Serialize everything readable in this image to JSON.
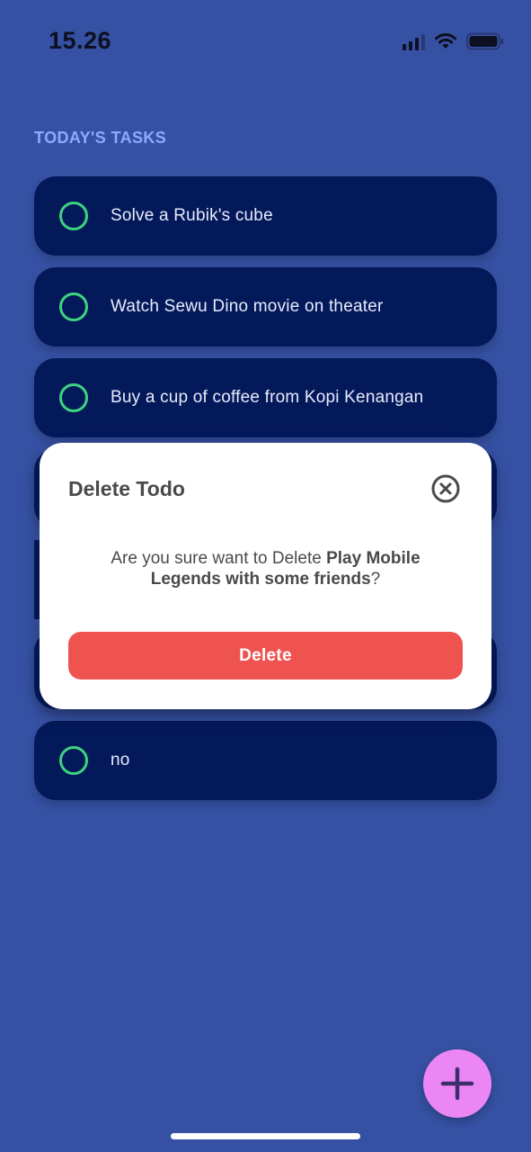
{
  "status_bar": {
    "time": "15.26",
    "icons": [
      "cellular-signal-icon",
      "wifi-icon",
      "battery-icon"
    ]
  },
  "section": {
    "title": "TODAY'S TASKS"
  },
  "tasks": [
    {
      "label": "Solve a Rubik's cube",
      "completed": false
    },
    {
      "label": "Watch Sewu Dino movie on theater",
      "completed": false
    },
    {
      "label": "Buy a cup of coffee from Kopi Kenangan",
      "completed": false
    },
    {
      "label": "",
      "completed": false
    },
    {
      "label": "",
      "completed": false
    },
    {
      "label": "no",
      "completed": false
    }
  ],
  "modal": {
    "title": "Delete Todo",
    "message_prefix": "Are you sure want to Delete ",
    "message_target": "Play Mobile Legends with some friends",
    "message_suffix": "?",
    "delete_label": "Delete",
    "close_icon": "close-circle-icon"
  },
  "fab": {
    "icon": "plus-icon"
  },
  "colors": {
    "background": "#3651a3",
    "card": "#04195a",
    "check_ring": "#3ed381",
    "section_title": "#8fa8ff",
    "delete_button": "#ef5350",
    "fab": "#ec86f4"
  }
}
